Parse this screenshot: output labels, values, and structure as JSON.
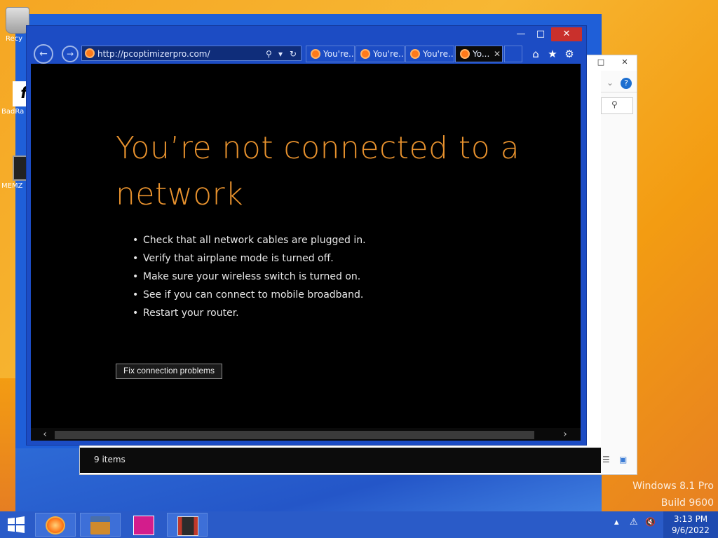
{
  "desktop": {
    "icons": [
      {
        "label": "Recy"
      },
      {
        "label": "BadRa"
      },
      {
        "label": "MEMZ"
      }
    ],
    "watermark": {
      "line1": "Windows 8.1 Pro",
      "line2": "Build 9600"
    }
  },
  "explorer": {
    "status": "9 items",
    "controls": {
      "maximize": "□",
      "close": "✕"
    }
  },
  "browser": {
    "window_controls": {
      "minimize": "—",
      "maximize": "□",
      "close": "✕"
    },
    "nav": {
      "back": "←",
      "forward": "→"
    },
    "address": {
      "url": "http://pcoptimizerpro.com/",
      "search_icon": "⚲",
      "dropdown": "▾",
      "refresh": "↻"
    },
    "tabs": [
      {
        "label": "You're..."
      },
      {
        "label": "You're..."
      },
      {
        "label": "You're..."
      },
      {
        "label": "Yo...",
        "close": "✕"
      }
    ],
    "toolbar": {
      "home": "⌂",
      "favorites": "★",
      "settings": "⚙"
    },
    "page": {
      "headline": "You’re not connected to a network",
      "tips": [
        "Check that all network cables are plugged in.",
        "Verify that airplane mode is turned off.",
        "Make sure your wireless switch is turned on.",
        "See if you can connect to mobile broadband.",
        "Restart your router."
      ],
      "fix_button": "Fix connection problems"
    },
    "scroll": {
      "left": "‹",
      "right": "›"
    }
  },
  "taskbar": {
    "apps": [
      "Internet Explorer",
      "File Explorer",
      "Store",
      "Media"
    ],
    "tray": {
      "arrow": "▴",
      "network": "⚠",
      "volume": "🔇"
    },
    "clock": {
      "time": "3:13 PM",
      "date": "9/6/2022"
    }
  }
}
